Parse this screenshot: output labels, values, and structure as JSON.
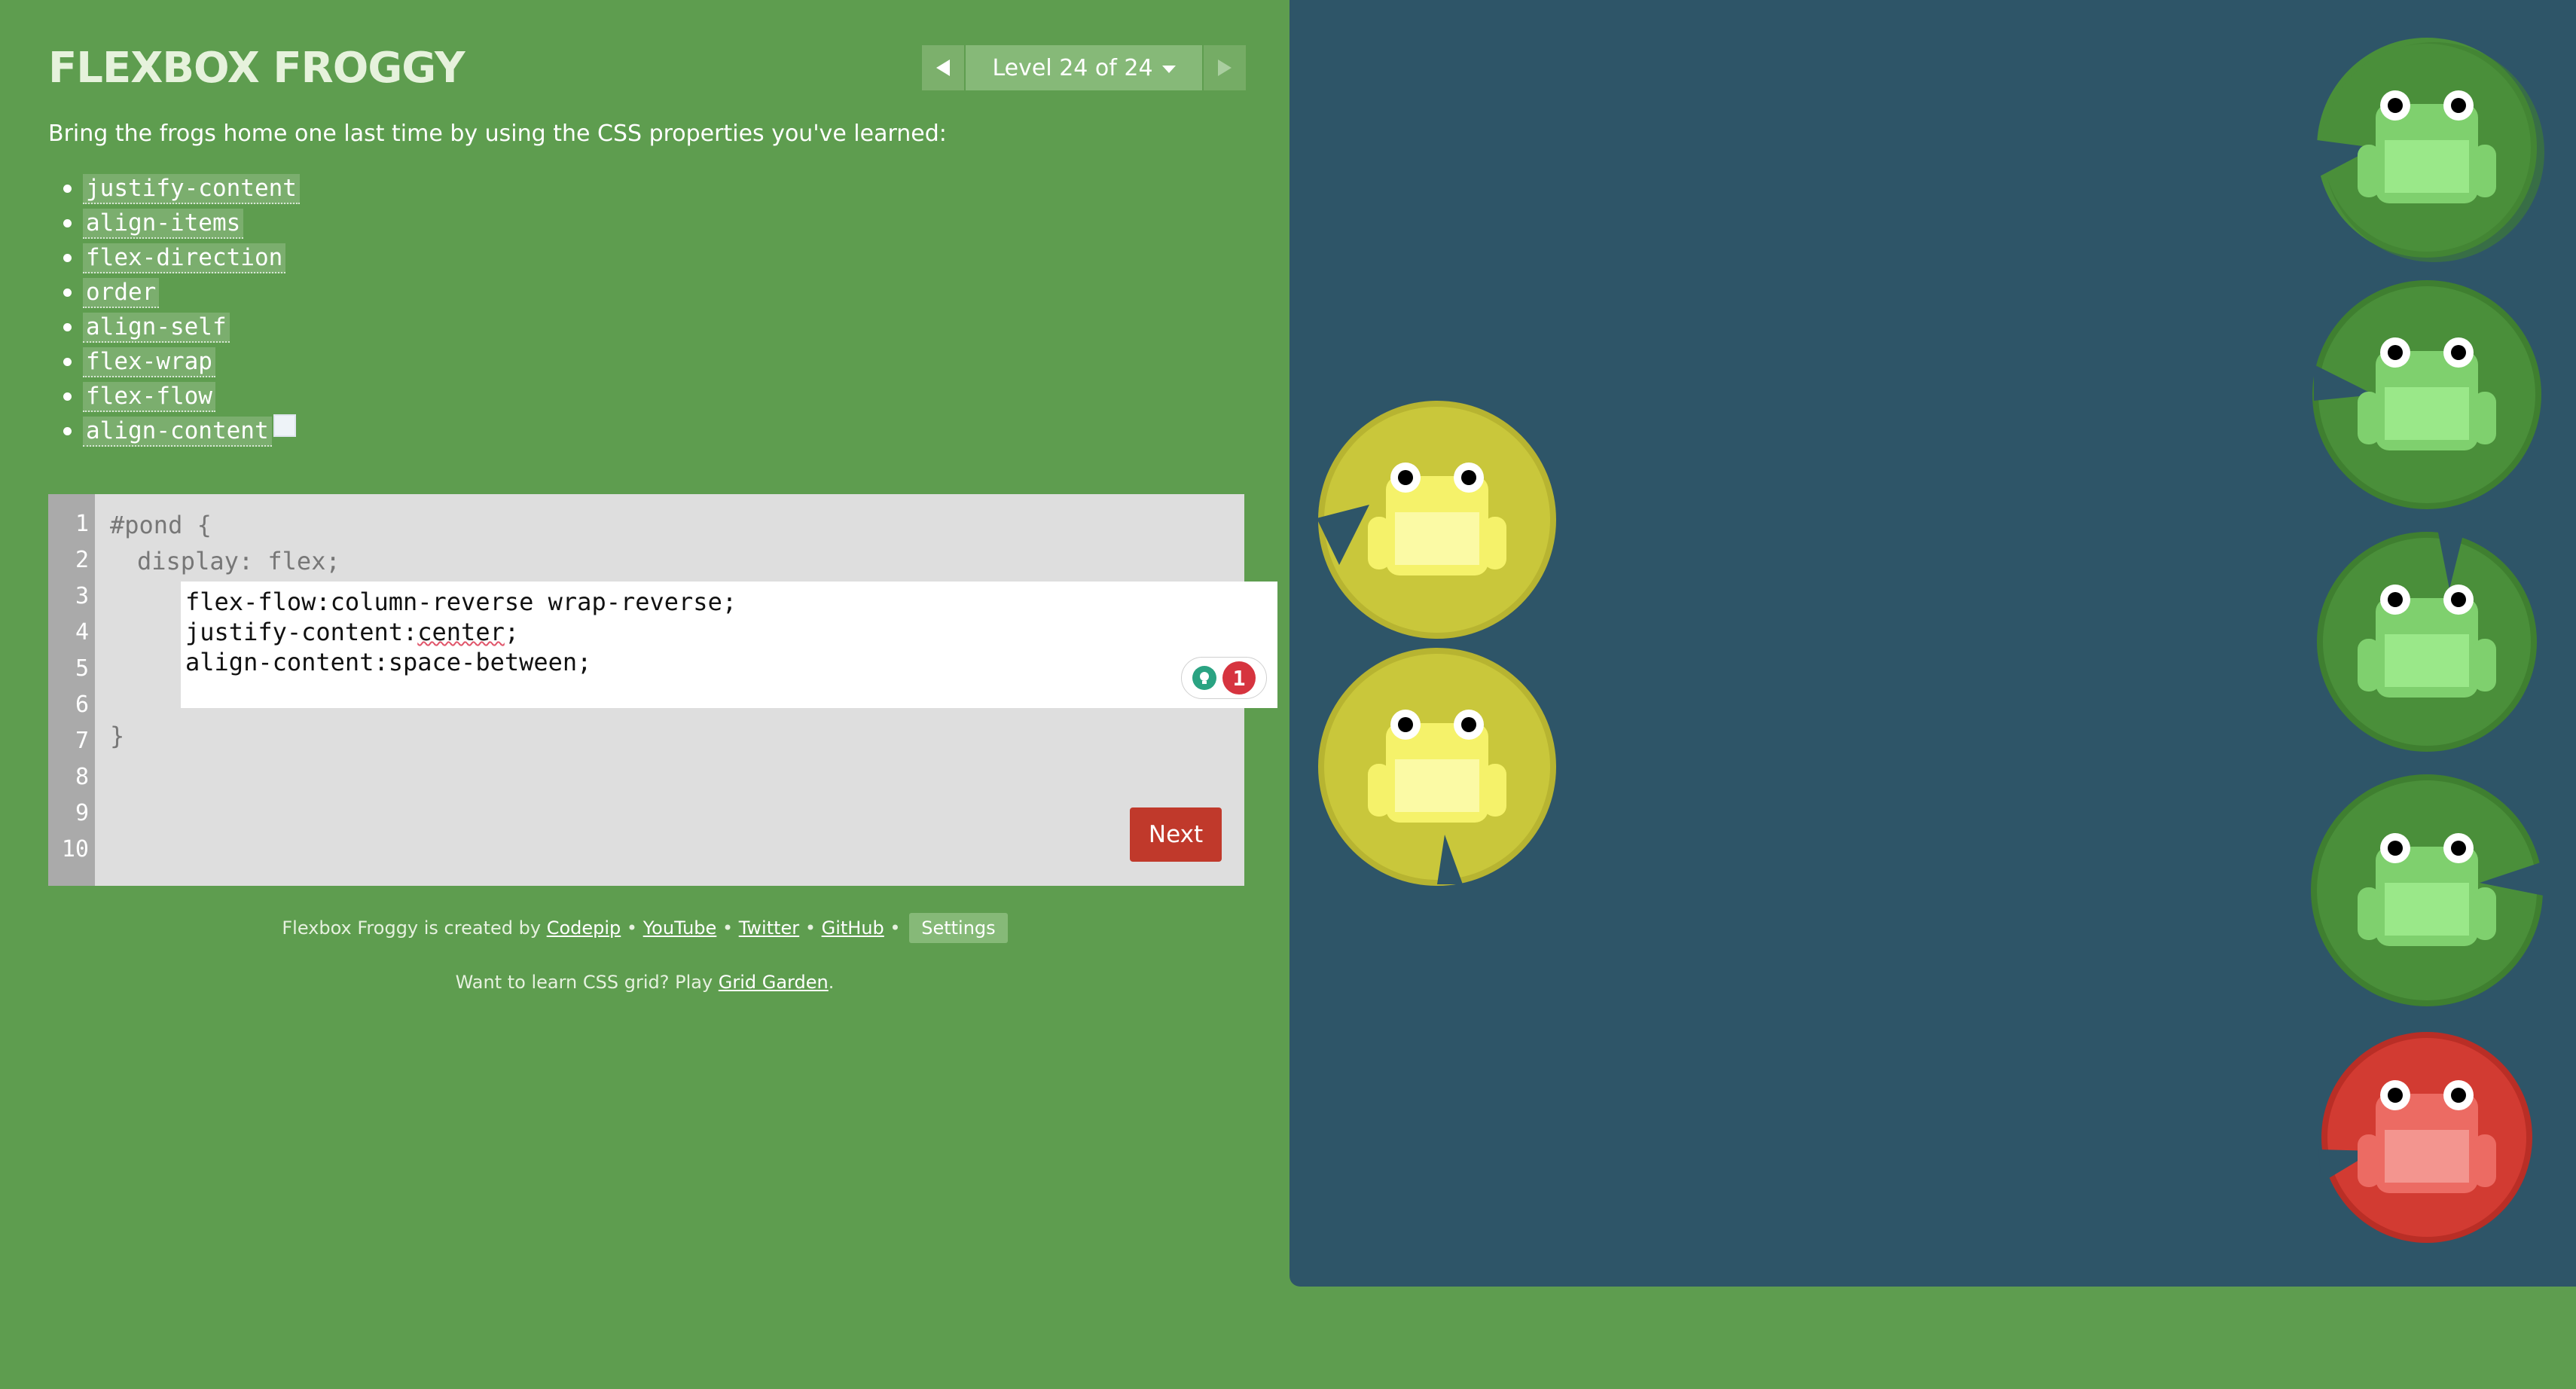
{
  "header": {
    "title": "FLEXBOX FROGGY",
    "level_label": "Level 24 of 24"
  },
  "instructions": "Bring the frogs home one last time by using the CSS properties you've learned:",
  "properties": [
    "justify-content",
    "align-items",
    "flex-direction",
    "order",
    "align-self",
    "flex-wrap",
    "flex-flow",
    "align-content"
  ],
  "editor": {
    "line_numbers": [
      "1",
      "2",
      "3",
      "4",
      "5",
      "6",
      "7",
      "8",
      "9",
      "10"
    ],
    "line1": "#pond {",
    "line2": "display: flex;",
    "input_lines": [
      "flex-flow:column-reverse wrap-reverse;",
      "justify-content:",
      "center",
      ";",
      "align-content:space-between;"
    ],
    "closing": "}",
    "grammar_count": "1",
    "next_label": "Next"
  },
  "footer": {
    "credit_prefix": "Flexbox Froggy is created by",
    "codepip": "Codepip",
    "youtube": "YouTube",
    "twitter": "Twitter",
    "github": "GitHub",
    "separator": "•",
    "settings": "Settings",
    "promo_prefix": "Want to learn CSS grid? Play",
    "promo_link": "Grid Garden",
    "promo_suffix": "."
  },
  "pond": {
    "lilypads": [
      "green",
      "green",
      "green",
      "green",
      "red"
    ],
    "frogs": [
      "yellow",
      "yellow"
    ]
  },
  "colors": {
    "page_bg": "#5e9d4f",
    "pond_bg": "#2e5568",
    "green_pad": "#4a8f3a",
    "red_pad": "#d23b32",
    "yellow_pad": "#c9c73b",
    "next_button": "#c0392b"
  }
}
